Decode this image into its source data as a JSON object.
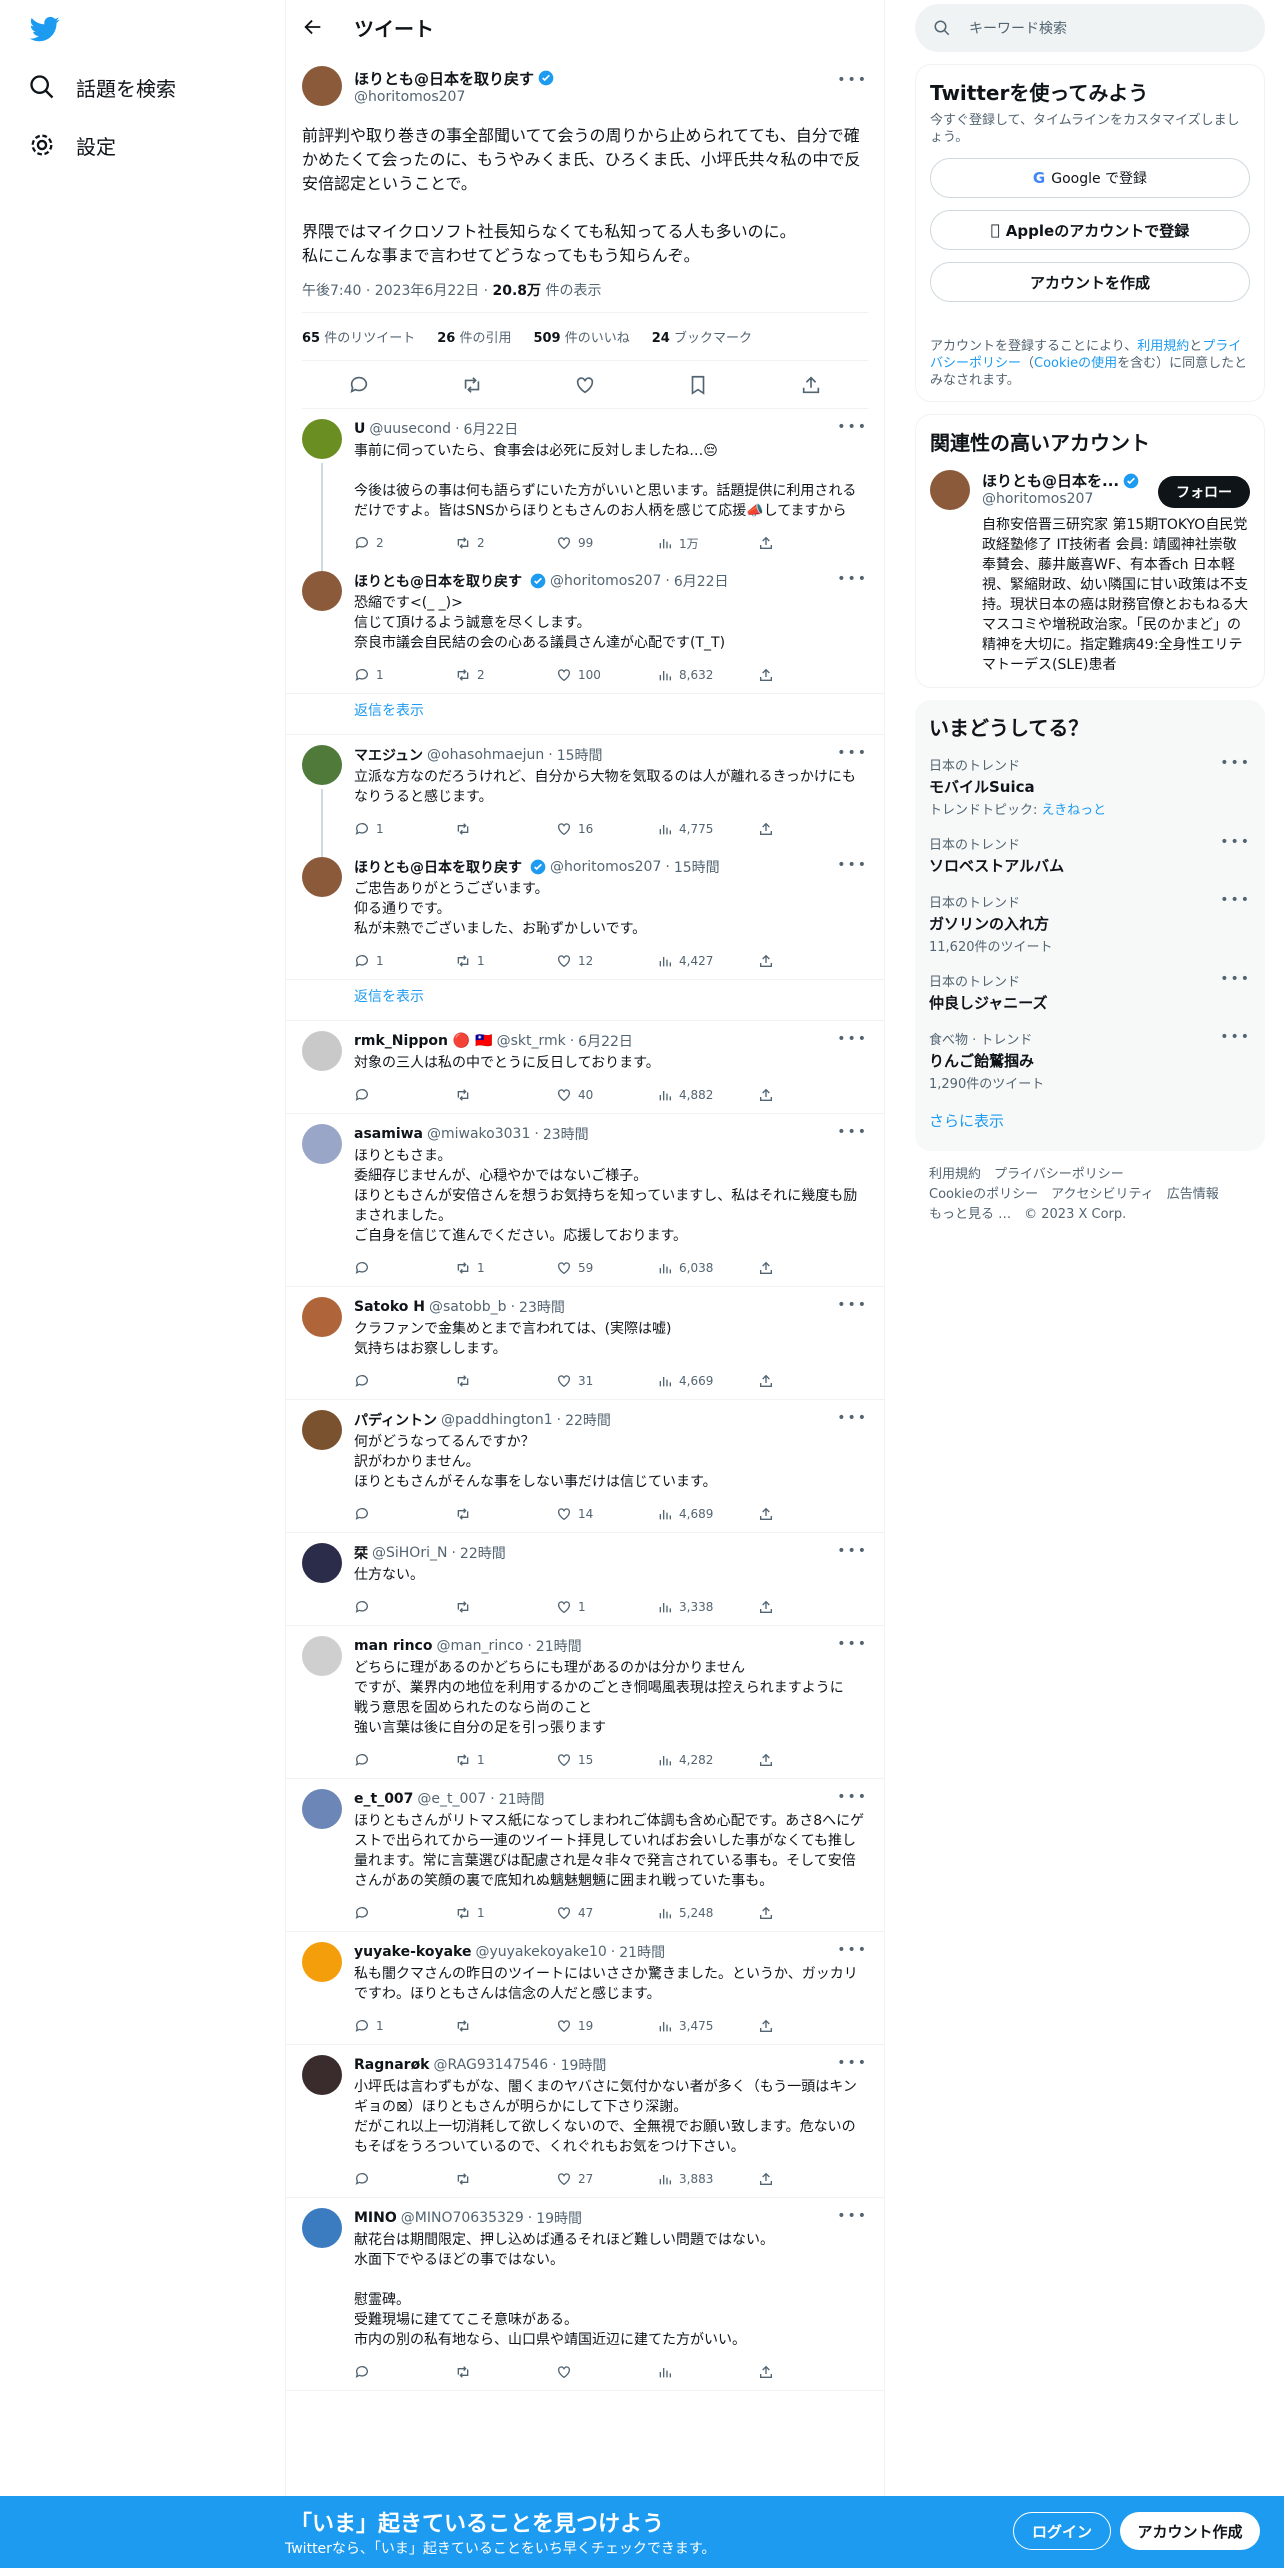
{
  "nav": {
    "search_label": "話題を検索",
    "settings_label": "設定"
  },
  "header": {
    "title": "ツイート"
  },
  "main_tweet": {
    "name": "ほりとも@日本を取り戻す",
    "handle": "@horitomos207",
    "text": "前評判や取り巻きの事全部聞いてて会うの周りから止められてても、自分で確かめたくて会ったのに、もうやみくま氏、ひろくま氏、小坪氏共々私の中で反安倍認定ということで。\n\n界隈ではマイクロソフト社長知らなくても私知ってる人も多いのに。\n私にこんな事まで言わせてどうなってももう知らんぞ。",
    "time": "午後7:40 · 2023年6月22日 · ",
    "views": "20.8万",
    "views_label": " 件の表示",
    "retweets": "65",
    "retweets_label": " 件のリツイート",
    "quotes": "26",
    "quotes_label": " 件の引用",
    "likes": "509",
    "likes_label": " 件のいいね",
    "bookmarks": "24",
    "bookmarks_label": " ブックマーク"
  },
  "replies": [
    {
      "name": "U",
      "handle": "@uusecond",
      "date": "6月22日",
      "text": "事前に伺っていたら、食事会は必死に反対しましたね…😔\n\n今後は彼らの事は何も語らずにいた方がいいと思います。話題提供に利用されるだけですよ。皆はSNSからほりともさんのお人柄を感じて応援📣してますから",
      "reply": "2",
      "rt": "2",
      "like": "99",
      "views": "1万"
    },
    {
      "name": "ほりとも@日本を取り戻す",
      "handle": "@horitomos207",
      "date": "6月22日",
      "text": "恐縮です<(_ _)>\n信じて頂けるよう誠意を尽くします。\n奈良市議会自民結の会の心ある議員さん達が心配です(T_T)",
      "reply": "1",
      "rt": "2",
      "like": "100",
      "views": "8,632"
    },
    {
      "name": "マエジュン",
      "handle": "@ohasohmaejun",
      "date": "15時間",
      "text": "立派な方なのだろうけれど、自分から大物を気取るのは人が離れるきっかけにもなりうると感じます。",
      "reply": "1",
      "rt": "",
      "like": "16",
      "views": "4,775"
    },
    {
      "name": "ほりとも@日本を取り戻す",
      "handle": "@horitomos207",
      "date": "15時間",
      "text": "ご忠告ありがとうございます。\n仰る通りです。\n私が未熟でございました、お恥ずかしいです。",
      "reply": "1",
      "rt": "1",
      "like": "12",
      "views": "4,427"
    },
    {
      "name": "rmk_Nippon 🔴 🇹🇼",
      "handle": "@skt_rmk",
      "date": "6月22日",
      "text": "対象の三人は私の中でとうに反日しております。",
      "reply": "",
      "rt": "",
      "like": "40",
      "views": "4,882"
    },
    {
      "name": "asamiwa",
      "handle": "@miwako3031",
      "date": "23時間",
      "text": "ほりともさま。\n委細存じませんが、心穏やかではないご様子。\nほりともさんが安倍さんを想うお気持ちを知っていますし、私はそれに幾度も励まされました。\nご自身を信じて進んでください。応援しております。",
      "reply": "",
      "rt": "1",
      "like": "59",
      "views": "6,038"
    },
    {
      "name": "Satoko H",
      "handle": "@satobb_b",
      "date": "23時間",
      "text": "クラファンで金集めとまで言われては、(実際は嘘)\n気持ちはお察しします。",
      "reply": "",
      "rt": "",
      "like": "31",
      "views": "4,669"
    },
    {
      "name": "パディントン",
      "handle": "@paddhington1",
      "date": "22時間",
      "text": "何がどうなってるんですか？\n訳がわかりません。\nほりともさんがそんな事をしない事だけは信じています。",
      "reply": "",
      "rt": "",
      "like": "14",
      "views": "4,689"
    },
    {
      "name": "栞",
      "handle": "@SiHOri_N",
      "date": "22時間",
      "text": "仕方ない。",
      "reply": "",
      "rt": "",
      "like": "1",
      "views": "3,338"
    },
    {
      "name": "man rinco",
      "handle": "@man_rinco",
      "date": "21時間",
      "text": "どちらに理があるのかどちらにも理があるのかは分かりません\nですが、業界内の地位を利用するかのごとき恫喝風表現は控えられますように\n戦う意思を固められたのなら尚のこと\n強い言葉は後に自分の足を引っ張ります",
      "reply": "",
      "rt": "1",
      "like": "15",
      "views": "4,282"
    },
    {
      "name": "e_t_007",
      "handle": "@e_t_007",
      "date": "21時間",
      "text": "ほりともさんがリトマス紙になってしまわれご体調も含め心配です。あさ8へにゲストで出られてから一連のツイート拝見していればお会いした事がなくても推し量れます。常に言葉選びは配慮され是々非々で発言されている事も。そして安倍さんがあの笑顔の裏で底知れぬ魑魅魍魎に囲まれ戦っていた事も。",
      "reply": "",
      "rt": "1",
      "like": "47",
      "views": "5,248"
    },
    {
      "name": "yuyake-koyake",
      "handle": "@yuyakekoyake10",
      "date": "21時間",
      "text": "私も闇クマさんの昨日のツイートにはいささか驚きました。というか、ガッカリですわ。ほりともさんは信念の人だと感じます。",
      "reply": "1",
      "rt": "",
      "like": "19",
      "views": "3,475"
    },
    {
      "name": "Ragnarøk",
      "handle": "@RAG93147546",
      "date": "19時間",
      "text": "小坪氏は言わずもがな、闇くまのヤバさに気付かない者が多く（もう一頭はキンギョの⊠）ほりともさんが明らかにして下さり深謝。\nだがこれ以上一切消耗して欲しくないので、全無視でお願い致します。危ないのもそばをうろついているので、くれぐれもお気をつけ下さい。",
      "reply": "",
      "rt": "",
      "like": "27",
      "views": "3,883"
    },
    {
      "name": "MINO",
      "handle": "@MINO70635329",
      "date": "19時間",
      "text": "献花台は期間限定、押し込めば通るそれほど難しい問題ではない。\n水面下でやるほどの事ではない。\n\n慰霊碑。\n受難現場に建ててこそ意味がある。\n市内の別の私有地なら、山口県や靖国近辺に建てた方がいい。",
      "reply": "",
      "rt": "",
      "like": "",
      "views": ""
    }
  ],
  "show_replies": "返信を表示",
  "search": {
    "placeholder": "キーワード検索"
  },
  "signup_card": {
    "title": "Twitterを使ってみよう",
    "subtitle": "今すぐ登録して、タイムラインをカスタマイズしましょう。",
    "google": "Google で登録",
    "apple": "Appleのアカウントで登録",
    "create": "アカウントを作成",
    "terms_pre": "アカウントを登録することにより、",
    "terms_link": "利用規約",
    "terms_and": "と",
    "privacy_link": "プライバシーポリシー",
    "cookie_pre": "（",
    "cookie_link": "Cookieの使用",
    "terms_post": "を含む）に同意したとみなされます。"
  },
  "related": {
    "title": "関連性の高いアカウント",
    "name": "ほりとも@日本を...",
    "handle": "@horitomos207",
    "follow": "フォロー",
    "bio": "自称安倍晋三研究家 第15期TOKYO自民党政経塾修了 IT技術者 会員: 靖國神社崇敬奉賛会、藤井厳喜WF、有本香ch 日本軽視、緊縮財政、幼い隣国に甘い政策は不支持。現状日本の癌は財務官僚とおもねる大マスコミや増税政治家。「民のかまど」の精神を大切に。指定難病49:全身性エリテマトーデス(SLE)患者"
  },
  "trends": {
    "title": "いまどうしてる？",
    "items": [
      {
        "cat": "日本のトレンド",
        "name": "モバイルSuica",
        "sub_pre": "トレンドトピック: ",
        "sub_link": "えきねっと"
      },
      {
        "cat": "日本のトレンド",
        "name": "ソロベストアルバム",
        "sub_pre": "",
        "sub_link": ""
      },
      {
        "cat": "日本のトレンド",
        "name": "ガソリンの入れ方",
        "sub_pre": "11,620件のツイート",
        "sub_link": ""
      },
      {
        "cat": "日本のトレンド",
        "name": "仲良しジャニーズ",
        "sub_pre": "",
        "sub_link": ""
      },
      {
        "cat": "食べ物 · トレンド",
        "name": "りんご飴鷲掴み",
        "sub_pre": "1,290件のツイート",
        "sub_link": ""
      }
    ],
    "more": "さらに表示"
  },
  "footer": {
    "l1": "利用規約　プライバシーポリシー",
    "l2": "Cookieのポリシー　アクセシビリティ　広告情報",
    "l3": "もっと見る …　© 2023 X Corp."
  },
  "banner": {
    "title": "「いま」起きていることを見つけよう",
    "sub": "Twitterなら、「いま」起きていることをいち早くチェックできます。",
    "login": "ログイン",
    "signup": "アカウント作成"
  },
  "colors": {
    "accent": "#1d9bf0",
    "text": "#0f1419",
    "muted": "#536471"
  }
}
